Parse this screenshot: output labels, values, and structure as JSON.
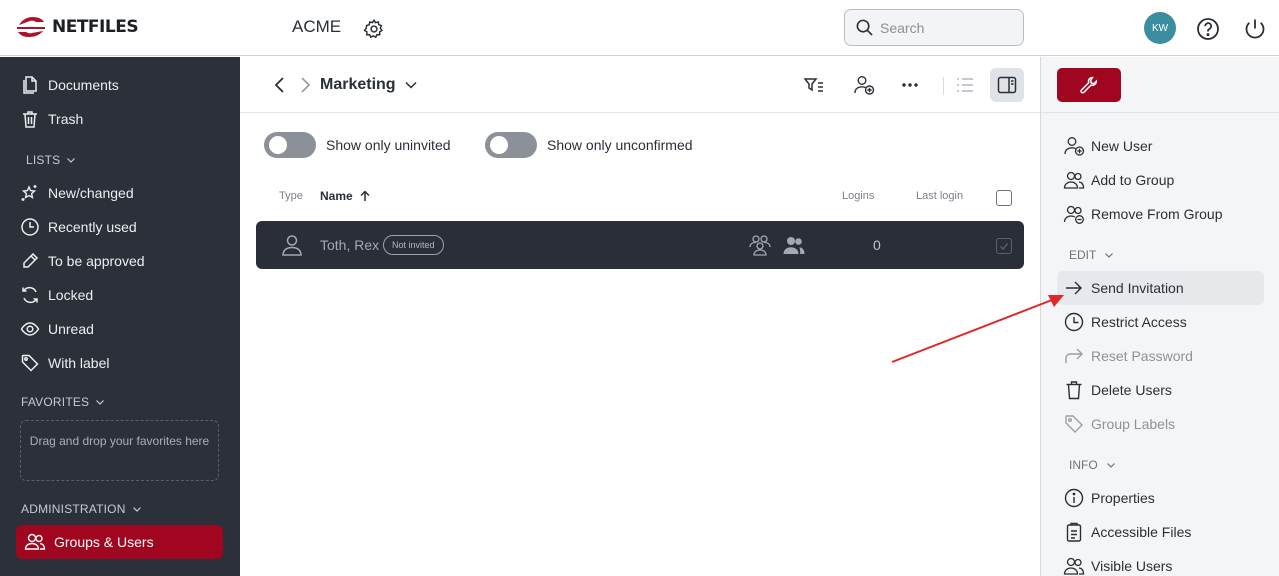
{
  "header": {
    "logo_text": "NETFILES",
    "org_title": "ACME",
    "search_placeholder": "Search",
    "avatar_initials": "KW"
  },
  "sidebar": {
    "top_items": [
      {
        "label": "Documents",
        "icon": "documents-icon"
      },
      {
        "label": "Trash",
        "icon": "trash-icon"
      }
    ],
    "lists_title": "LISTS",
    "list_items": [
      {
        "label": "New/changed",
        "icon": "sparkle-star-icon"
      },
      {
        "label": "Recently used",
        "icon": "clock-icon"
      },
      {
        "label": "To be approved",
        "icon": "pencil-icon"
      },
      {
        "label": "Locked",
        "icon": "refresh-icon"
      },
      {
        "label": "Unread",
        "icon": "eye-icon"
      },
      {
        "label": "With label",
        "icon": "tag-icon"
      }
    ],
    "favorites_title": "FAVORITES",
    "favorites_hint": "Drag and drop your favorites here",
    "administration_title": "ADMINISTRATION",
    "active_item": {
      "label": "Groups & Users",
      "icon": "users-icon"
    }
  },
  "main": {
    "breadcrumb_title": "Marketing",
    "toolbar_icons": [
      "filter-icon",
      "add-user-icon",
      "more-icon",
      "list-view-icon",
      "panel-toggle-icon"
    ],
    "toggles": [
      {
        "label": "Show only uninvited",
        "on": false
      },
      {
        "label": "Show only unconfirmed",
        "on": false
      }
    ],
    "columns": {
      "type": "Type",
      "name": "Name",
      "logins": "Logins",
      "last_login": "Last login"
    },
    "rows": [
      {
        "name": "Toth, Rex",
        "badge": "Not invited",
        "logins": "0",
        "last_login": "",
        "selected": true
      }
    ]
  },
  "right_panel": {
    "user_items": [
      {
        "label": "New User",
        "icon": "add-user-icon",
        "disabled": false
      },
      {
        "label": "Add to Group",
        "icon": "add-to-group-icon",
        "disabled": false
      },
      {
        "label": "Remove From Group",
        "icon": "remove-from-group-icon",
        "disabled": false
      }
    ],
    "edit_title": "EDIT",
    "edit_items": [
      {
        "label": "Send Invitation",
        "icon": "arrow-right-icon",
        "disabled": false,
        "highlighted": true
      },
      {
        "label": "Restrict Access",
        "icon": "clock-icon",
        "disabled": false
      },
      {
        "label": "Reset Password",
        "icon": "reset-arrow-icon",
        "disabled": true
      },
      {
        "label": "Delete Users",
        "icon": "trash-icon",
        "disabled": false
      },
      {
        "label": "Group Labels",
        "icon": "tag-icon",
        "disabled": true
      }
    ],
    "info_title": "INFO",
    "info_items": [
      {
        "label": "Properties",
        "icon": "info-icon",
        "disabled": false
      },
      {
        "label": "Accessible Files",
        "icon": "clipboard-icon",
        "disabled": false
      },
      {
        "label": "Visible Users",
        "icon": "visible-users-icon",
        "disabled": false
      }
    ]
  },
  "colors": {
    "brand": "#a0061f",
    "sidebar_bg": "#2c3039",
    "annotation_arrow": "#e0262b",
    "avatar": "#3b8d9f"
  }
}
